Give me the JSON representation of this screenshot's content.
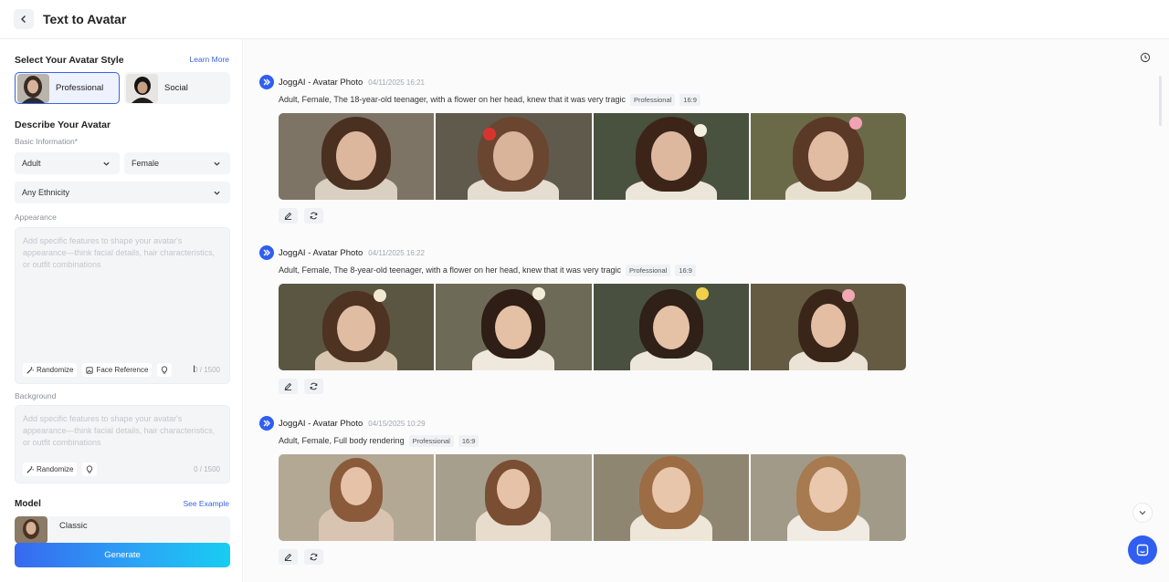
{
  "header": {
    "title": "Text to Avatar"
  },
  "left": {
    "style_section": {
      "title": "Select Your Avatar Style",
      "learn_more": "Learn More",
      "options": [
        {
          "label": "Professional",
          "selected": true
        },
        {
          "label": "Social",
          "selected": false
        }
      ]
    },
    "describe": {
      "title": "Describe Your Avatar",
      "basic_label": "Basic Information*",
      "age": "Adult",
      "gender": "Female",
      "ethnicity": "Any Ethnicity"
    },
    "appearance": {
      "label": "Appearance",
      "placeholder": "Add specific features to shape your avatar's appearance—think facial details, hair characteristics, or outfit combinations",
      "randomize": "Randomize",
      "face_reference": "Face Reference",
      "counter": "0 / 1500"
    },
    "background": {
      "label": "Background",
      "placeholder": "Add specific features to shape your avatar's appearance—think facial details, hair characteristics, or outfit combinations",
      "randomize": "Randomize",
      "counter": "0 / 1500"
    },
    "model": {
      "title": "Model",
      "see_example": "See Example",
      "selected": "Classic"
    },
    "generate_label": "Generate"
  },
  "feed": [
    {
      "name": "JoggAI - Avatar Photo",
      "time": "04/11/2025 16:21",
      "desc": "Adult, Female, The 18-year-old teenager, with a flower on her head, knew that it was very tragic",
      "tags": [
        "Professional",
        "16:9"
      ]
    },
    {
      "name": "JoggAI - Avatar Photo",
      "time": "04/11/2025 16:22",
      "desc": "Adult, Female, The 8-year-old teenager, with a flower on her head, knew that it was very tragic",
      "tags": [
        "Professional",
        "16:9"
      ]
    },
    {
      "name": "JoggAI - Avatar Photo",
      "time": "04/15/2025 10:29",
      "desc": "Adult, Female, Full body rendering",
      "tags": [
        "Professional",
        "16:9"
      ]
    }
  ],
  "colors": {
    "accent": "#3a63e6",
    "brand": "#2f5ef0"
  }
}
